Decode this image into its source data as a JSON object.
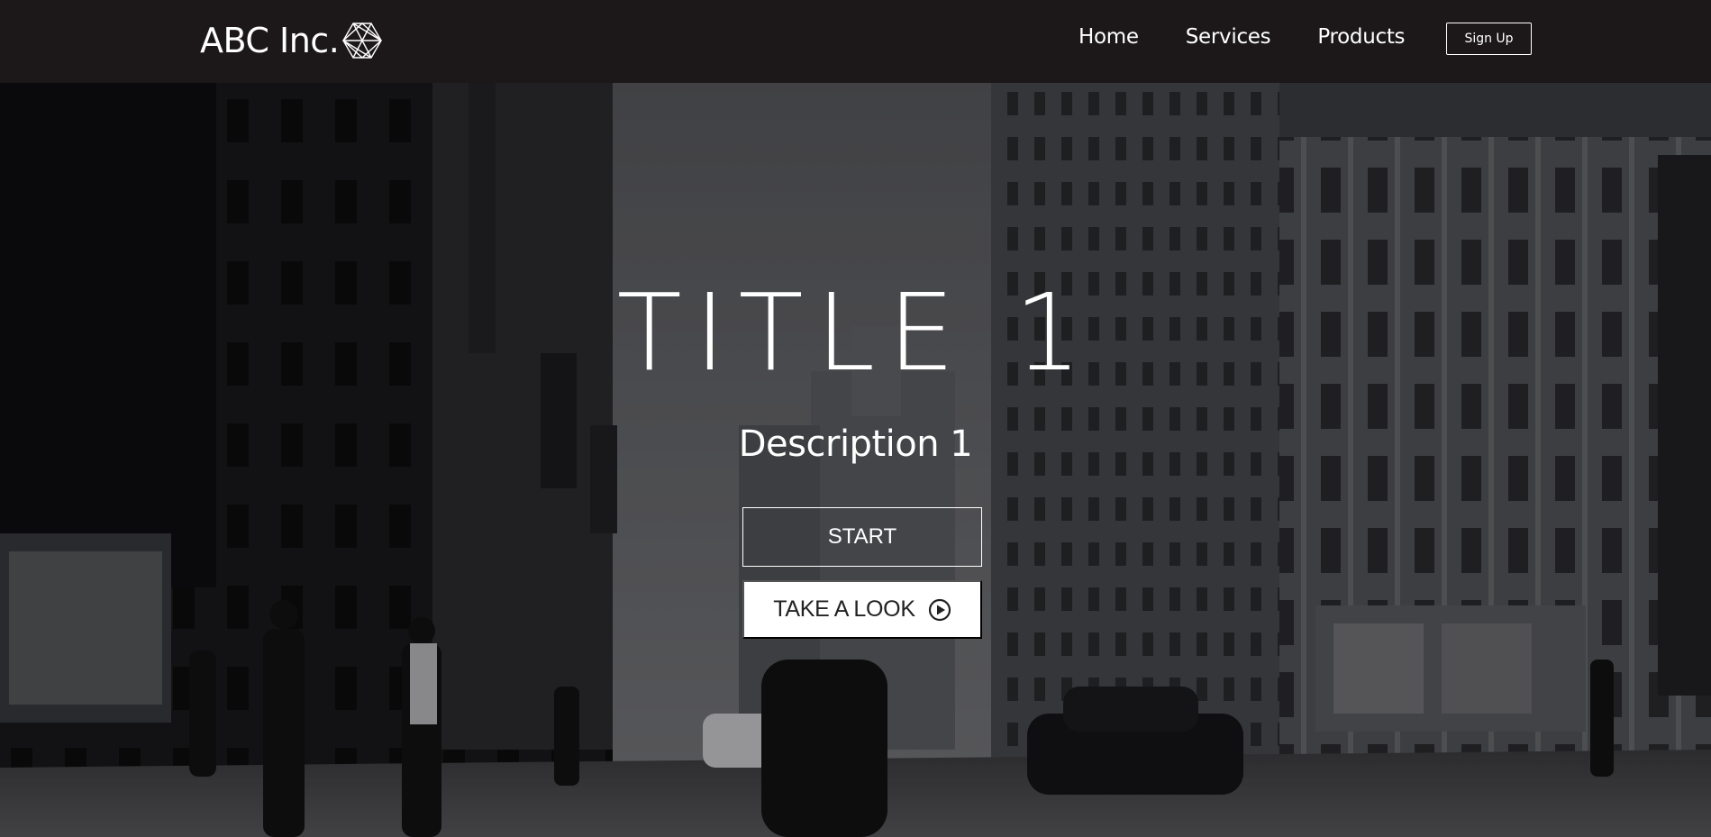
{
  "header": {
    "logo_text": "ABC Inc.",
    "logo_icon": "polygon-wireframe-icon",
    "nav": [
      {
        "label": "Home"
      },
      {
        "label": "Services"
      },
      {
        "label": "Products"
      }
    ],
    "signup_label": "Sign Up"
  },
  "hero": {
    "title": "TITLE 1",
    "description": "Description 1",
    "start_label": "START",
    "look_label": "TAKE A LOOK",
    "look_icon": "play-circle-icon",
    "bg_overlay_color": "#000000"
  }
}
